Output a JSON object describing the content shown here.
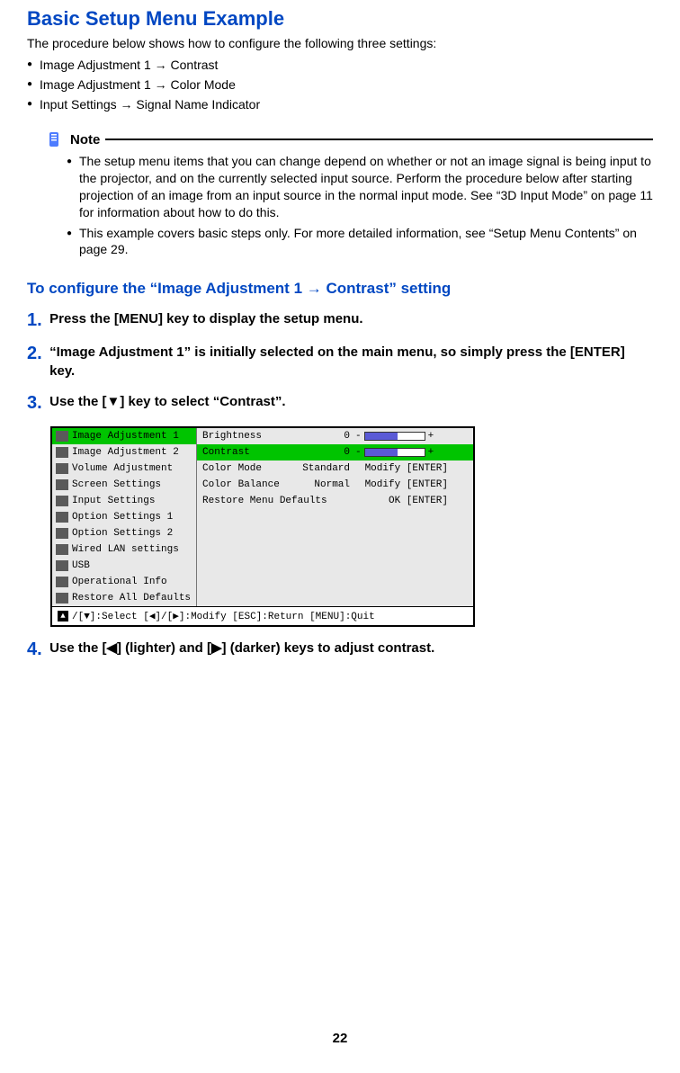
{
  "title": "Basic Setup Menu Example",
  "intro": "The procedure below shows how to configure the following three settings:",
  "intro_bullets": [
    "Image Adjustment 1 → Contrast",
    "Image Adjustment 1 → Color Mode",
    "Input Settings → Signal Name Indicator"
  ],
  "note_label": "Note",
  "note_items": [
    "The setup menu items that you can change depend on whether or not an image signal is being input to the projector, and on the currently selected input source. Perform the procedure below after starting projection of an image from an input source in the normal input mode. See “3D Input Mode” on page 11 for information about how to do this.",
    "This example covers basic steps only. For more detailed information, see “Setup Menu Contents” on page 29."
  ],
  "subhead": "To configure the “Image Adjustment 1 → Contrast” setting",
  "steps": {
    "n1": "1.",
    "t1": "Press the [MENU] key to display the setup menu.",
    "n2": "2.",
    "t2": "“Image Adjustment 1” is initially selected on the main menu, so simply press the [ENTER] key.",
    "n3": "3.",
    "t3": "Use the [▼] key to select “Contrast”.",
    "n4": "4.",
    "t4": "Use the [◀] (lighter) and [▶] (darker) keys to adjust contrast."
  },
  "menu": {
    "left": [
      "Image Adjustment 1",
      "Image Adjustment 2",
      "Volume Adjustment",
      "Screen Settings",
      "Input Settings",
      "Option Settings 1",
      "Option Settings 2",
      "Wired LAN settings",
      "USB",
      "Operational Info",
      "Restore All Defaults"
    ],
    "right": [
      {
        "label": "Brightness",
        "val": "0",
        "bar": true,
        "action": ""
      },
      {
        "label": "Contrast",
        "val": "0",
        "bar": true,
        "action": ""
      },
      {
        "label": "Color Mode",
        "val": "Standard",
        "bar": false,
        "action": "Modify [ENTER]"
      },
      {
        "label": "Color Balance",
        "val": "Normal",
        "bar": false,
        "action": "Modify [ENTER]"
      },
      {
        "label": "Restore Menu Defaults",
        "val": "",
        "bar": false,
        "action": "OK [ENTER]"
      }
    ],
    "footer": "/[▼]:Select [◀]/[▶]:Modify [ESC]:Return [MENU]:Quit"
  },
  "page_number": "22"
}
